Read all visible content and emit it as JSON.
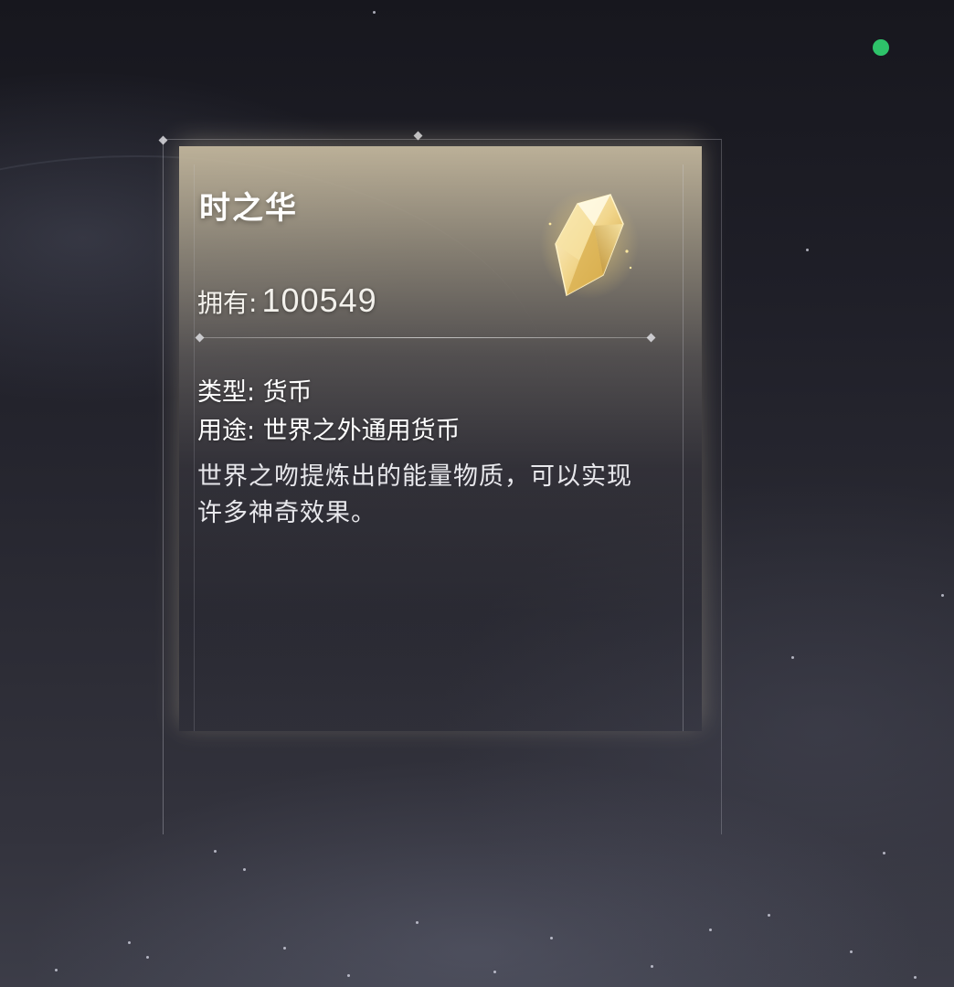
{
  "item": {
    "name": "时之华",
    "owned_label": "拥有:",
    "owned_value": "100549",
    "type_line": "类型: 货币",
    "usage_line": "用途: 世界之外通用货币",
    "description": "世界之吻提炼出的能量物质，可以实现许多神奇效果。",
    "icon": "crystal-icon"
  },
  "status_indicator": {
    "color": "#2ec36a"
  }
}
